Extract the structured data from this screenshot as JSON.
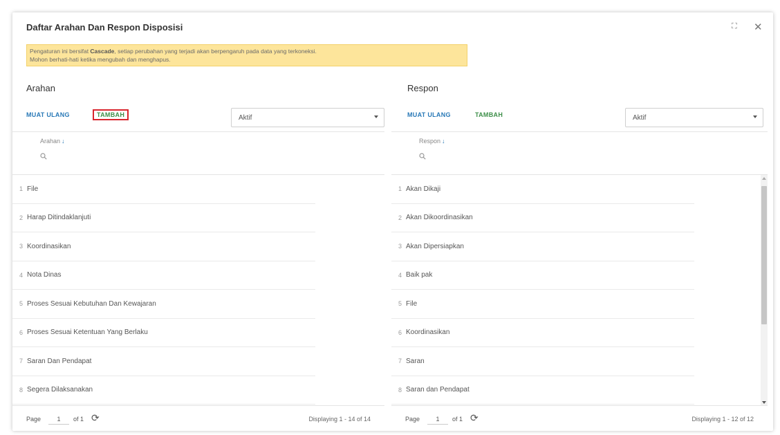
{
  "dialog": {
    "title": "Daftar Arahan Dan Respon Disposisi",
    "notice_prefix": "Pengaturan ini bersifat ",
    "notice_bold": "Cascade",
    "notice_rest": ", setiap perubahan yang terjadi akan berpengaruh pada data yang terkoneksi.",
    "notice_line2": "Mohon berhati-hati ketika mengubah dan menghapus."
  },
  "arahan": {
    "title": "Arahan",
    "reload_label": "MUAT ULANG",
    "add_label": "TAMBAH",
    "filter_value": "Aktif",
    "column_header": "Arahan",
    "rows": [
      {
        "idx": "1",
        "label": "File"
      },
      {
        "idx": "2",
        "label": "Harap Ditindaklanjuti"
      },
      {
        "idx": "3",
        "label": "Koordinasikan"
      },
      {
        "idx": "4",
        "label": "Nota Dinas"
      },
      {
        "idx": "5",
        "label": "Proses Sesuai Kebutuhan Dan Kewajaran"
      },
      {
        "idx": "6",
        "label": "Proses Sesuai Ketentuan Yang Berlaku"
      },
      {
        "idx": "7",
        "label": "Saran Dan Pendapat"
      },
      {
        "idx": "8",
        "label": "Segera Dilaksanakan"
      }
    ],
    "page_label": "Page",
    "page_value": "1",
    "of_label": "of 1",
    "display_text": "Displaying 1 - 14 of 14"
  },
  "respon": {
    "title": "Respon",
    "reload_label": "MUAT ULANG",
    "add_label": "TAMBAH",
    "filter_value": "Aktif",
    "column_header": "Respon",
    "rows": [
      {
        "idx": "1",
        "label": "Akan Dikaji"
      },
      {
        "idx": "2",
        "label": "Akan Dikoordinasikan"
      },
      {
        "idx": "3",
        "label": "Akan Dipersiapkan"
      },
      {
        "idx": "4",
        "label": "Baik pak"
      },
      {
        "idx": "5",
        "label": "File"
      },
      {
        "idx": "6",
        "label": "Koordinasikan"
      },
      {
        "idx": "7",
        "label": "Saran"
      },
      {
        "idx": "8",
        "label": "Saran dan Pendapat"
      }
    ],
    "page_label": "Page",
    "page_value": "1",
    "of_label": "of 1",
    "display_text": "Displaying 1 - 12 of 12"
  },
  "colors": {
    "reload": "#2979b7",
    "add": "#3e8f4a",
    "highlight_border": "#d8252c",
    "notice_bg": "#fde59b"
  },
  "icons": {
    "expand": "expand-icon",
    "close": "close-icon",
    "sort": "arrow-down-icon",
    "search": "search-icon",
    "refresh": "refresh-icon",
    "dropdown": "caret-down-icon"
  }
}
